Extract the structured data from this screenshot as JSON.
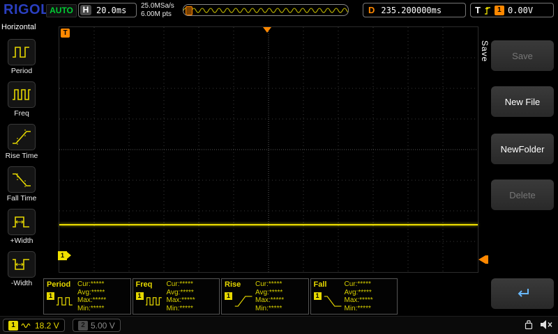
{
  "top_bar": {
    "logo": "RIGOL",
    "run_status": "AUTO",
    "horizontal": {
      "label": "H",
      "timebase": "20.0ms"
    },
    "acquisition": {
      "sample_rate": "25.0MSa/s",
      "memory_depth": "6.00M pts"
    },
    "delay": {
      "label": "D",
      "value": "235.200000ms"
    },
    "trigger": {
      "label": "T",
      "source": "1",
      "level": "0.00V"
    }
  },
  "left_sidebar": {
    "title": "Horizontal",
    "items": [
      {
        "label": "Period"
      },
      {
        "label": "Freq"
      },
      {
        "label": "Rise Time"
      },
      {
        "label": "Fall Time"
      },
      {
        "label": "+Width"
      },
      {
        "label": "-Width"
      }
    ]
  },
  "graticule": {
    "trigger_position_marker": "T",
    "channel_marker": "1"
  },
  "right_panel": {
    "menu_tab": "Save",
    "buttons": [
      {
        "label": "Save",
        "enabled": false
      },
      {
        "label": "New File",
        "enabled": true
      },
      {
        "label": "NewFolder",
        "enabled": true
      },
      {
        "label": "Delete",
        "enabled": false
      }
    ],
    "enter_button_icon": "return-arrow"
  },
  "measurements": [
    {
      "name": "Period",
      "channel": "1",
      "lines": [
        "Cur:*****",
        "Avg:*****",
        "Max:*****",
        "Min:*****"
      ]
    },
    {
      "name": "Freq",
      "channel": "1",
      "lines": [
        "Cur:*****",
        "Avg:*****",
        "Max:*****",
        "Min:*****"
      ]
    },
    {
      "name": "Rise",
      "channel": "1",
      "lines": [
        "Cur:*****",
        "Avg:*****",
        "Max:*****",
        "Min:*****"
      ]
    },
    {
      "name": "Fall",
      "channel": "1",
      "lines": [
        "Cur:*****",
        "Avg:*****",
        "Max:*****",
        "Min:*****"
      ]
    }
  ],
  "status_bar": {
    "channels": [
      {
        "number": "1",
        "scale": "18.2 V",
        "active": true
      },
      {
        "number": "2",
        "scale": "5.00 V",
        "active": false
      }
    ]
  },
  "colors": {
    "channel1_yellow": "#f0e000",
    "trigger_orange": "#ff8800",
    "auto_green": "#00cc33",
    "logo_blue": "#2a3fc0"
  }
}
